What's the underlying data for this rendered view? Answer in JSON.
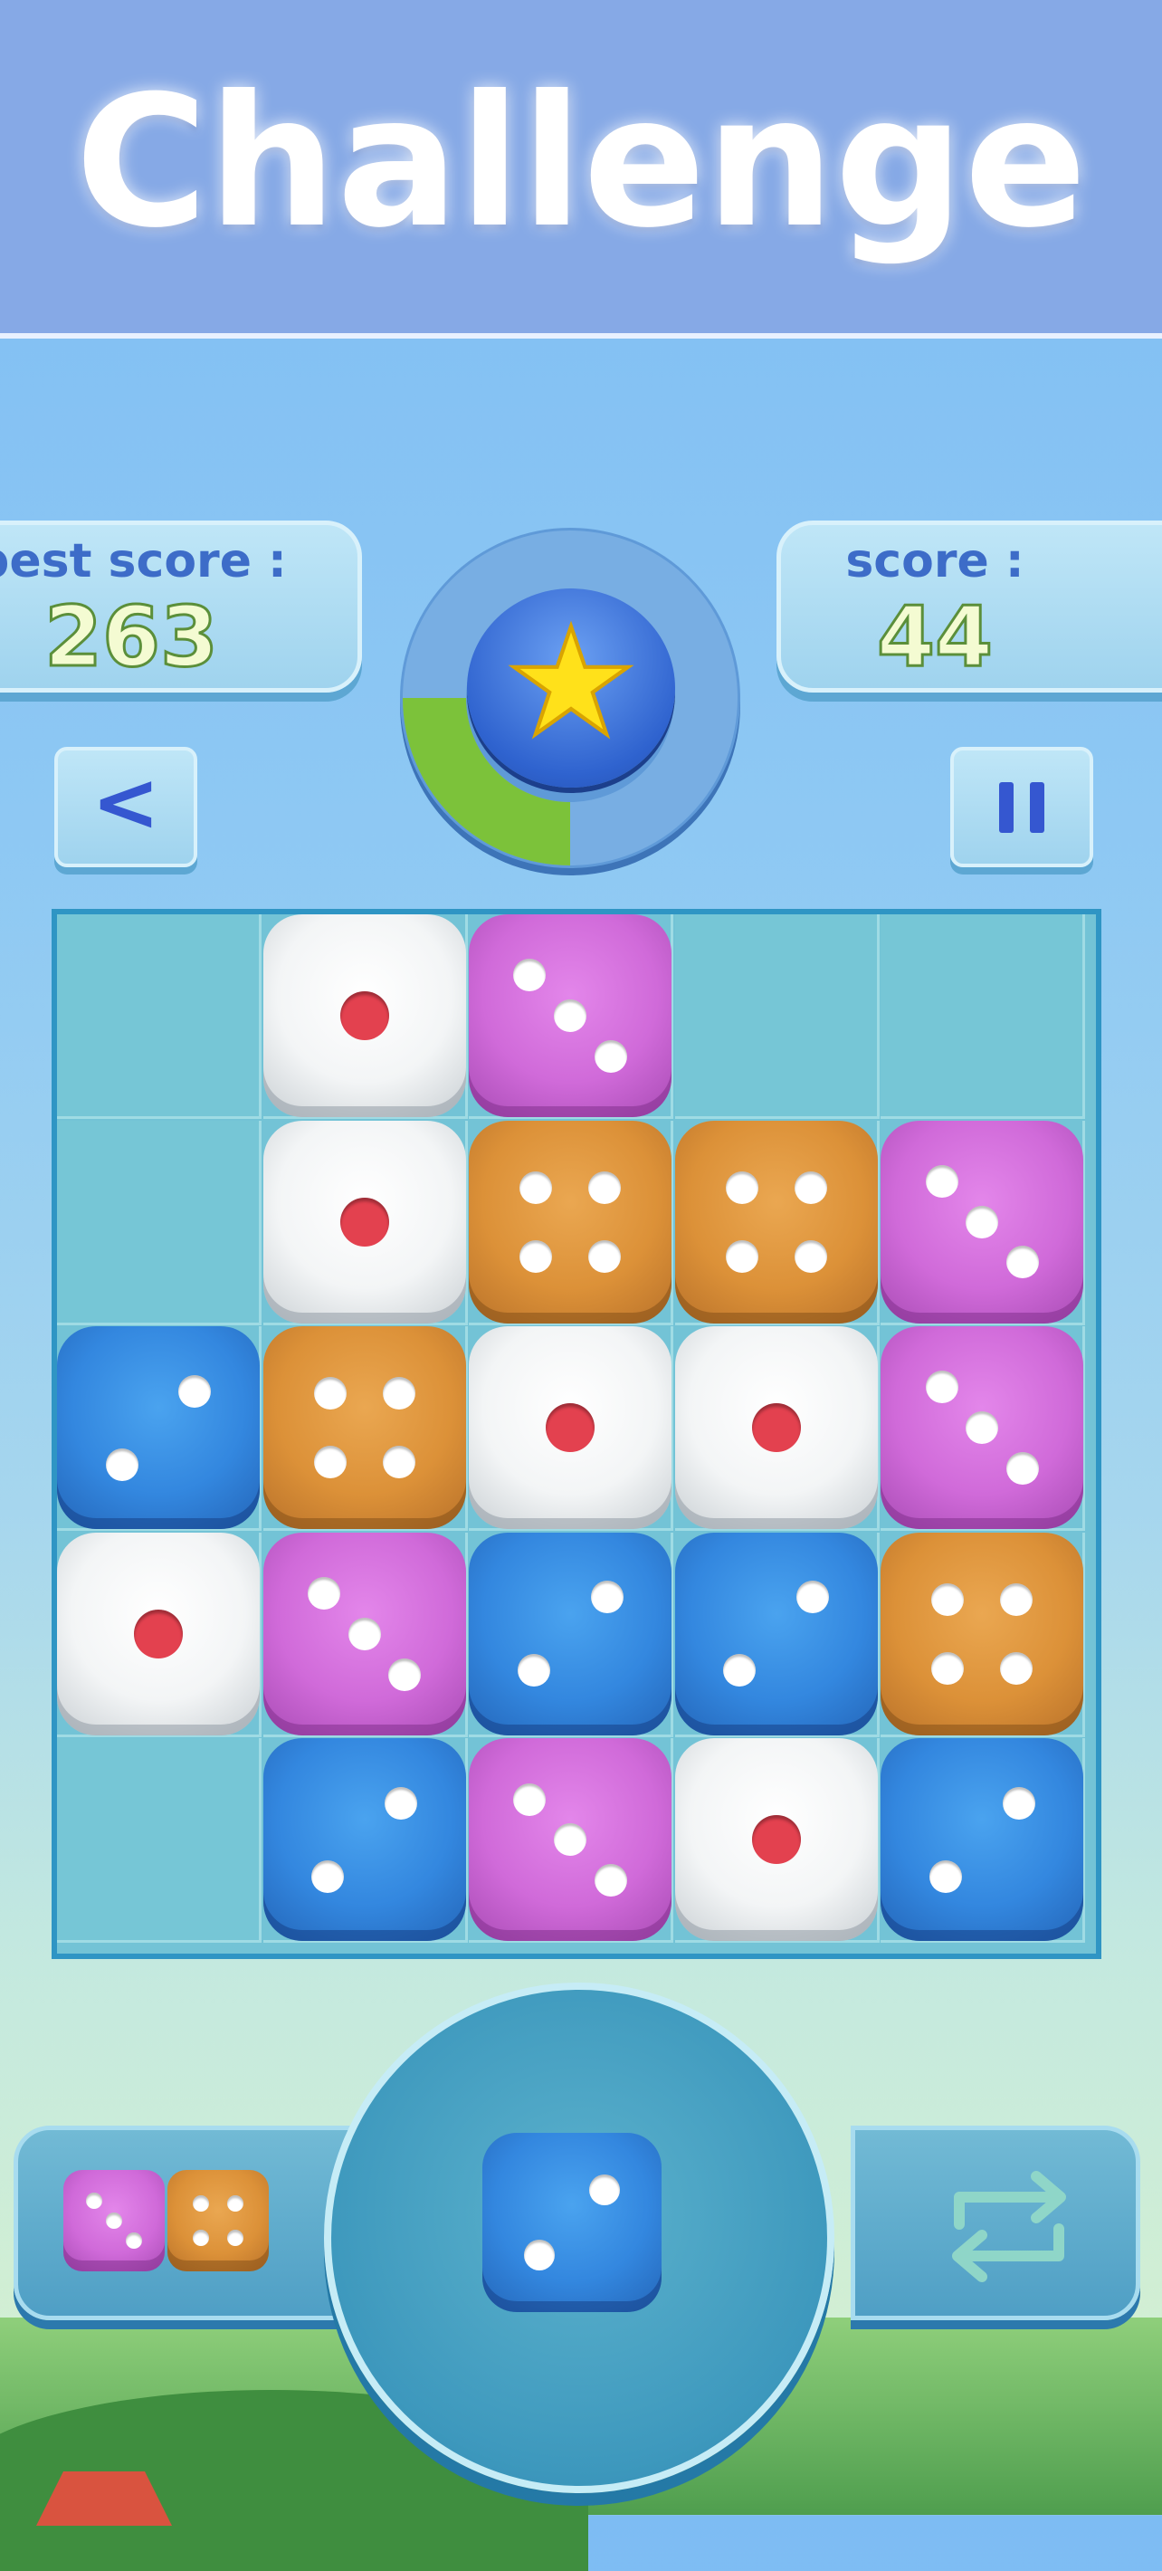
{
  "banner": {
    "title": "Challenge"
  },
  "scores": {
    "best_label": "best score :",
    "best_value": "263",
    "current_label": "score :",
    "current_value": "44"
  },
  "meter": {
    "icon": "star-icon",
    "progress": 0.25
  },
  "buttons": {
    "back_label": "<",
    "pause_icon": "pause-icon",
    "swap_icon": "swap-arrows-icon"
  },
  "colors": {
    "white": "#f3f5f6",
    "pink": "#d06ad9",
    "orange": "#dc9138",
    "blue": "#3387df"
  },
  "board": {
    "rows": 5,
    "cols": 5,
    "cells": [
      [
        null,
        {
          "color": "white",
          "pips": 1
        },
        {
          "color": "pink",
          "pips": 3
        },
        null,
        null
      ],
      [
        null,
        {
          "color": "white",
          "pips": 1
        },
        {
          "color": "orange",
          "pips": 4
        },
        {
          "color": "orange",
          "pips": 4
        },
        {
          "color": "pink",
          "pips": 3
        }
      ],
      [
        {
          "color": "blue",
          "pips": 2
        },
        {
          "color": "orange",
          "pips": 4
        },
        {
          "color": "white",
          "pips": 1
        },
        {
          "color": "white",
          "pips": 1
        },
        {
          "color": "pink",
          "pips": 3
        }
      ],
      [
        {
          "color": "white",
          "pips": 1
        },
        {
          "color": "pink",
          "pips": 3
        },
        {
          "color": "blue",
          "pips": 2
        },
        {
          "color": "blue",
          "pips": 2
        },
        {
          "color": "orange",
          "pips": 4
        }
      ],
      [
        null,
        {
          "color": "blue",
          "pips": 2
        },
        {
          "color": "pink",
          "pips": 3
        },
        {
          "color": "white",
          "pips": 1
        },
        {
          "color": "blue",
          "pips": 2
        }
      ]
    ]
  },
  "next_queue": [
    {
      "color": "pink",
      "pips": 3
    },
    {
      "color": "orange",
      "pips": 4
    }
  ],
  "current_die": {
    "color": "blue",
    "pips": 2
  }
}
